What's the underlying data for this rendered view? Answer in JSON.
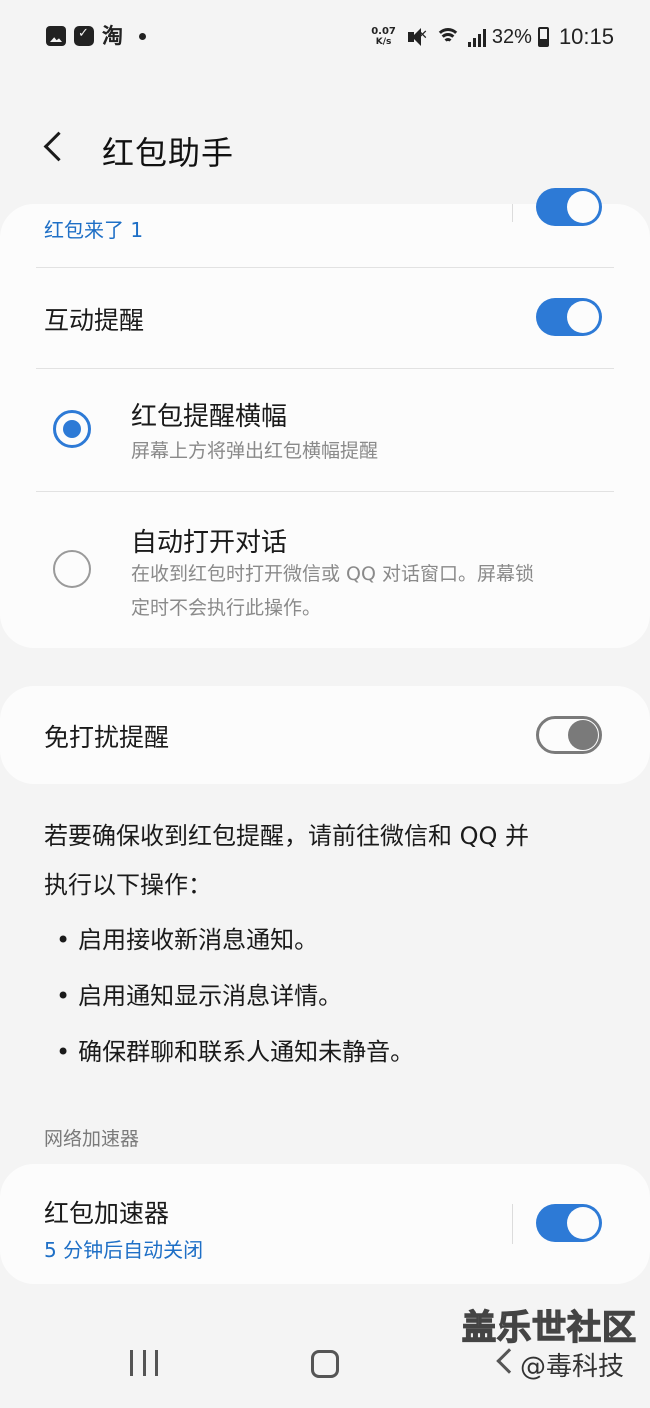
{
  "status_bar": {
    "app_icon_3": "淘",
    "net_speed_value": "0.07",
    "net_speed_unit": "K/s",
    "battery": "32%",
    "time": "10:15",
    "icons": [
      "gallery-icon",
      "app-icon",
      "taobao-icon",
      "dot-icon",
      "mute-icon",
      "wifi-icon",
      "signal-icon",
      "battery-icon"
    ]
  },
  "header": {
    "title": "红包助手"
  },
  "card1": {
    "top_item_sub": "红包来了 1",
    "top_item_toggle": true,
    "interactive_reminder": {
      "label": "互动提醒",
      "toggle": true
    },
    "options": [
      {
        "title": "红包提醒横幅",
        "desc": "屏幕上方将弹出红包横幅提醒",
        "selected": true
      },
      {
        "title": "自动打开对话",
        "desc_line1": "在收到红包时打开微信或 QQ 对话窗口。屏幕锁",
        "desc_line2": "定时不会执行此操作。",
        "selected": false
      }
    ]
  },
  "card2": {
    "label": "免打扰提醒",
    "toggle": false
  },
  "info": {
    "line1": "若要确保收到红包提醒，请前往微信和 QQ 并",
    "line2": "执行以下操作：",
    "bullets": [
      "启用接收新消息通知。",
      "启用通知显示消息详情。",
      "确保群聊和联系人通知未静音。"
    ]
  },
  "section_header": "网络加速器",
  "card3": {
    "label": "红包加速器",
    "sub": "5 分钟后自动关闭",
    "toggle": true
  },
  "watermark": {
    "line1": "盖乐世社区",
    "line2": "@毒科技"
  },
  "colors": {
    "accent": "#2d7ad6",
    "accent_text": "#1e6fc6",
    "background": "#f4f4f4",
    "card": "#fcfcfc"
  }
}
